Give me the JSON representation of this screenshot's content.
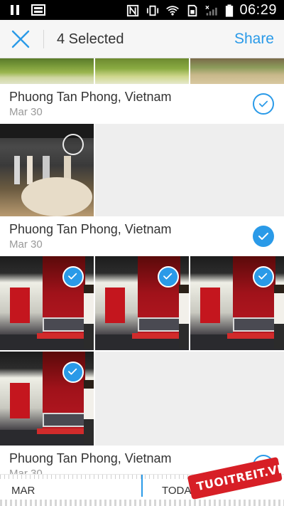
{
  "status_bar": {
    "time": "06:29",
    "icons": [
      "pause-icon",
      "image-notification-icon",
      "nfc-icon",
      "vibrate-icon",
      "wifi-icon",
      "sim-icon",
      "signal-icon",
      "battery-icon"
    ]
  },
  "app_bar": {
    "close_icon": "close-icon",
    "title": "4 Selected",
    "share_label": "Share"
  },
  "groups": [
    {
      "location": "Phuong Tan Phong, Vietnam",
      "date": "Mar 30",
      "selected": false
    },
    {
      "location": "Phuong Tan Phong, Vietnam",
      "date": "Mar 30",
      "selected": true
    },
    {
      "location": "Phuong Tan Phong, Vietnam",
      "date": "Mar 30",
      "selected": false
    }
  ],
  "photos": {
    "meeting_selected": false,
    "event_1_selected": true,
    "event_2_selected": true,
    "event_3_selected": true,
    "event_4_selected": true
  },
  "scrubber": {
    "left_label": "MAR",
    "right_label": "TODA"
  },
  "watermark": {
    "text": "TUOITREIT.VN"
  },
  "colors": {
    "accent": "#2a9ae8",
    "watermark_red": "#d71f26"
  }
}
